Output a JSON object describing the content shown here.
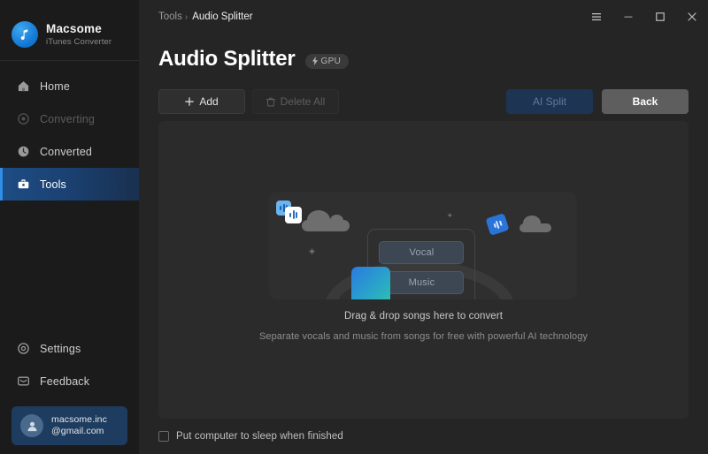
{
  "brand": {
    "name": "Macsome",
    "subtitle": "iTunes Converter",
    "logo_icon": "music-note-icon"
  },
  "sidebar": {
    "items": [
      {
        "label": "Home",
        "icon": "home-icon",
        "state": "normal"
      },
      {
        "label": "Converting",
        "icon": "converting-icon",
        "state": "disabled"
      },
      {
        "label": "Converted",
        "icon": "clock-icon",
        "state": "normal"
      },
      {
        "label": "Tools",
        "icon": "toolbox-icon",
        "state": "active"
      }
    ],
    "bottom_items": [
      {
        "label": "Settings",
        "icon": "gear-icon"
      },
      {
        "label": "Feedback",
        "icon": "message-icon"
      }
    ],
    "account": {
      "email_line1": "macsome.inc",
      "email_line2": "@gmail.com",
      "avatar_icon": "user-avatar-icon"
    }
  },
  "titlebar": {
    "breadcrumb_parent": "Tools",
    "breadcrumb_separator": "›",
    "breadcrumb_current": "Audio Splitter",
    "window_controls": [
      {
        "name": "menu-icon",
        "glyph": "menu"
      },
      {
        "name": "minimize-icon",
        "glyph": "minimize"
      },
      {
        "name": "maximize-icon",
        "glyph": "maximize"
      },
      {
        "name": "close-icon",
        "glyph": "close"
      }
    ]
  },
  "page": {
    "title": "Audio Splitter",
    "badge": {
      "label": "GPU",
      "icon": "lightning-bolt-icon"
    }
  },
  "toolbar": {
    "add_label": "Add",
    "add_icon": "plus-icon",
    "delete_all_label": "Delete All",
    "delete_all_icon": "trash-icon",
    "ai_split_label": "AI Split",
    "back_label": "Back"
  },
  "content": {
    "caption_main": "Drag & drop songs here to convert",
    "caption_sub": "Separate vocals and music from songs for free with powerful AI technology",
    "illustration": {
      "vocal_label": "Vocal",
      "music_label": "Music",
      "sparkle_glyph": "✦",
      "card_icon": "audio-waveform-icon",
      "float_icon": "audio-waveform-icon"
    }
  },
  "footer": {
    "sleep_checkbox_label": "Put computer to sleep when finished",
    "sleep_checkbox_checked": false
  },
  "colors": {
    "accent_blue": "#2f8fe8",
    "active_nav_gradient_start": "#1d4d84",
    "account_card": "#1d3c5f",
    "card_gradient_start": "#2b7ae0",
    "card_gradient_end": "#2fc4a8",
    "sidebar_bg": "#1b1b1b",
    "main_bg": "#252525",
    "panel_bg": "#2b2b2b"
  }
}
